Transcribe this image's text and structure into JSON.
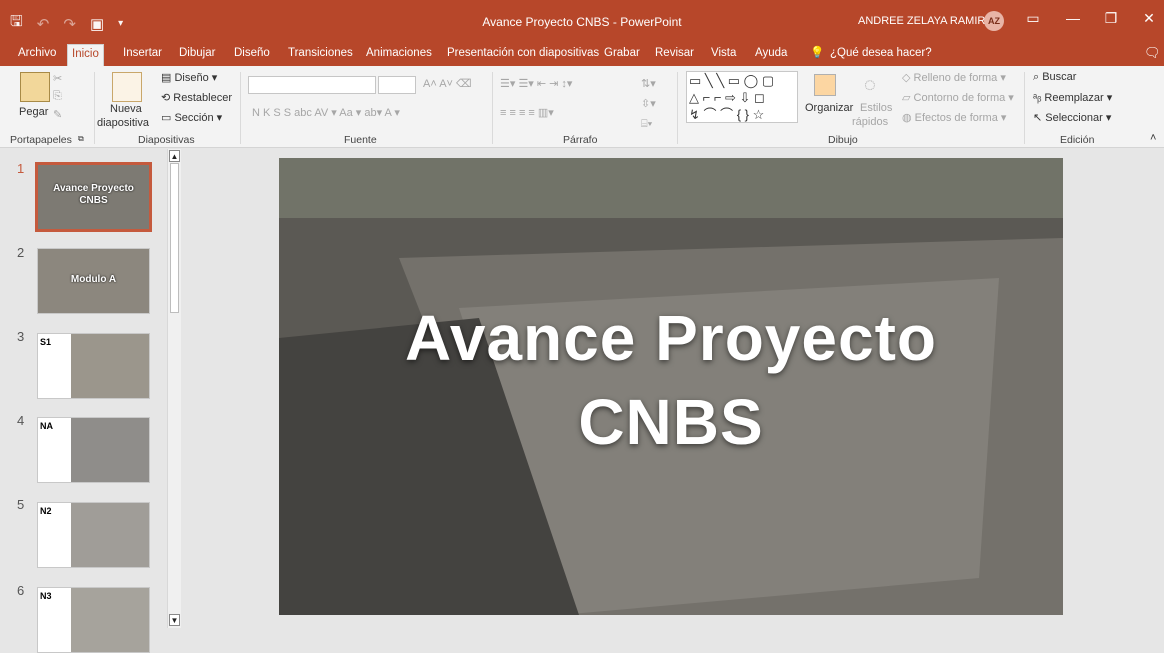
{
  "window": {
    "title": "Avance Proyecto CNBS  -  PowerPoint",
    "user_name": "ANDREE ZELAYA RAMIREZ",
    "user_initials": "AZ"
  },
  "tabs": [
    "Archivo",
    "Inicio",
    "Insertar",
    "Dibujar",
    "Diseño",
    "Transiciones",
    "Animaciones",
    "Presentación con diapositivas",
    "Grabar",
    "Revisar",
    "Vista",
    "Ayuda"
  ],
  "tell_me": "¿Qué desea hacer?",
  "ribbon": {
    "portapapeles": {
      "label": "Portapapeles",
      "paste": "Pegar"
    },
    "diapositivas": {
      "label": "Diapositivas",
      "new_slide_1": "Nueva",
      "new_slide_2": "diapositiva",
      "layout": "Diseño",
      "reset": "Restablecer",
      "section": "Sección"
    },
    "fuente": {
      "label": "Fuente"
    },
    "parrafo": {
      "label": "Párrafo"
    },
    "dibujo": {
      "label": "Dibujo",
      "arrange": "Organizar",
      "quick_styles_1": "Estilos",
      "quick_styles_2": "rápidos",
      "fill": "Relleno de forma",
      "outline": "Contorno de forma",
      "effects": "Efectos de forma"
    },
    "edicion": {
      "label": "Edición",
      "find": "Buscar",
      "replace": "Reemplazar",
      "select": "Seleccionar"
    }
  },
  "slides": [
    {
      "num": "1",
      "title": "Avance Proyecto CNBS",
      "selected": true
    },
    {
      "num": "2",
      "title": "Modulo A"
    },
    {
      "num": "3",
      "title": "S1"
    },
    {
      "num": "4",
      "title": "NA"
    },
    {
      "num": "5",
      "title": "N2"
    },
    {
      "num": "6",
      "title": "N3"
    }
  ],
  "current_slide": {
    "title_line1": "Avance Proyecto",
    "title_line2": "CNBS"
  },
  "colors": {
    "accent": "#b7472a",
    "ribbon_bg": "#f3f3f3",
    "selected_thumb": "#c55a3d"
  }
}
